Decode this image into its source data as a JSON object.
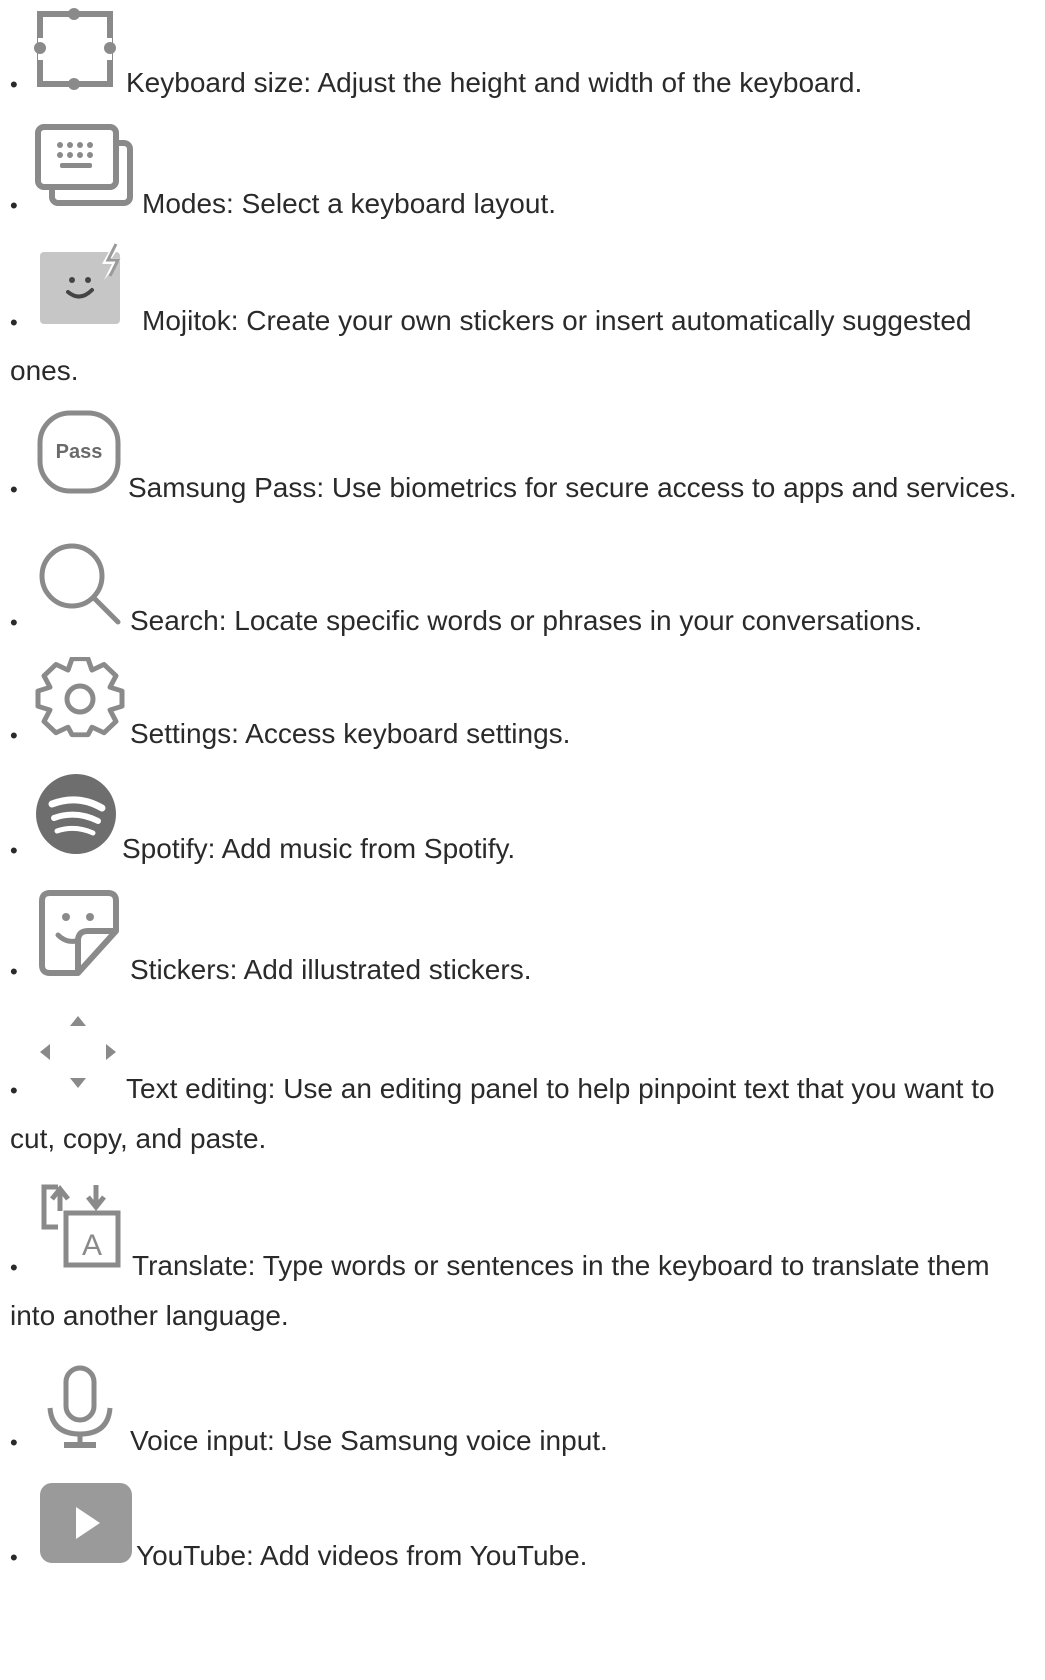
{
  "items": [
    {
      "icon": "keyboard-size-icon",
      "text": "Keyboard size: Adjust the height and width of the keyboard."
    },
    {
      "icon": "modes-icon",
      "text": "Modes: Select a keyboard layout."
    },
    {
      "icon": "mojitok-icon",
      "text": "Mojitok: Create your own stickers or insert automatically suggested ones."
    },
    {
      "icon": "samsung-pass-icon",
      "icon_label": "Pass",
      "text": "Samsung Pass: Use biometrics for secure access to apps and services."
    },
    {
      "icon": "search-icon",
      "text": "Search: Locate specific words or phrases in your conversations."
    },
    {
      "icon": "settings-gear-icon",
      "text": "Settings: Access keyboard settings."
    },
    {
      "icon": "spotify-icon",
      "text": "Spotify: Add music from Spotify."
    },
    {
      "icon": "stickers-icon",
      "text": "Stickers: Add illustrated stickers."
    },
    {
      "icon": "text-editing-arrows-icon",
      "text": "Text editing: Use an editing panel to help pinpoint text that you want to cut, copy, and paste."
    },
    {
      "icon": "translate-icon",
      "icon_label": "A",
      "text": "Translate: Type words or sentences in the keyboard to translate them into another language."
    },
    {
      "icon": "microphone-icon",
      "text": "Voice input: Use Samsung voice input."
    },
    {
      "icon": "youtube-play-icon",
      "text": "YouTube: Add videos from YouTube."
    }
  ],
  "colors": {
    "text": "#2a2a2a",
    "icon_stroke": "#8a8a8a",
    "icon_fill": "#8c8c8c",
    "icon_fill_light": "#bdbdbd"
  }
}
